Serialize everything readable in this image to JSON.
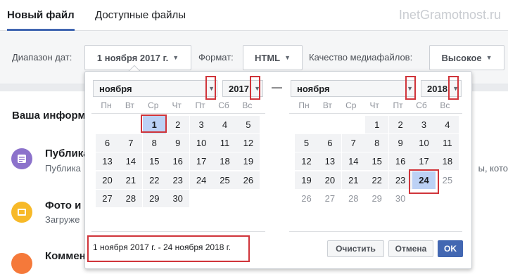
{
  "tabs": {
    "active": "Новый файл",
    "other": "Доступные файлы"
  },
  "watermark": "InetGramotnost.ru",
  "filters": {
    "range_label": "Диапазон дат:",
    "range_value": "1 ноября 2017 г.",
    "format_label": "Формат:",
    "format_value": "HTML",
    "quality_label": "Качество медиафайлов:",
    "quality_value": "Высокое"
  },
  "section": {
    "title": "Ваша информ"
  },
  "items": [
    {
      "title": "Публика",
      "sub": "Публика",
      "cut": "ы, кото"
    },
    {
      "title": "Фото и",
      "sub": "Загруже"
    },
    {
      "title": "Коммен"
    }
  ],
  "picker": {
    "left": {
      "month": "ноября",
      "year": "2017",
      "days": [
        "1",
        "2",
        "3",
        "4",
        "5",
        "6",
        "7",
        "8",
        "9",
        "10",
        "11",
        "12",
        "13",
        "14",
        "15",
        "16",
        "17",
        "18",
        "19",
        "20",
        "21",
        "22",
        "23",
        "24",
        "25",
        "26",
        "27",
        "28",
        "29",
        "30"
      ]
    },
    "right": {
      "month": "ноября",
      "year": "2018",
      "days": [
        "1",
        "2",
        "3",
        "4",
        "5",
        "6",
        "7",
        "8",
        "9",
        "10",
        "11",
        "12",
        "13",
        "14",
        "15",
        "16",
        "17",
        "18",
        "19",
        "20",
        "21",
        "22",
        "23",
        "24",
        "25",
        "26",
        "27",
        "28",
        "29",
        "30"
      ]
    },
    "weekdays": [
      "Пн",
      "Вт",
      "Ср",
      "Чт",
      "Пт",
      "Сб",
      "Вс"
    ],
    "dash": "—",
    "result": "1 ноября 2017 г. - 24 ноября 2018 г.",
    "clear": "Очистить",
    "cancel": "Отмена",
    "ok": "OK"
  },
  "colors": {
    "accent": "#4267b2",
    "highlight": "#d0343a",
    "selected": "#bcd1f5"
  },
  "icons": {
    "item1": "posts-icon",
    "item2": "photos-icon",
    "item3": "comments-icon"
  }
}
